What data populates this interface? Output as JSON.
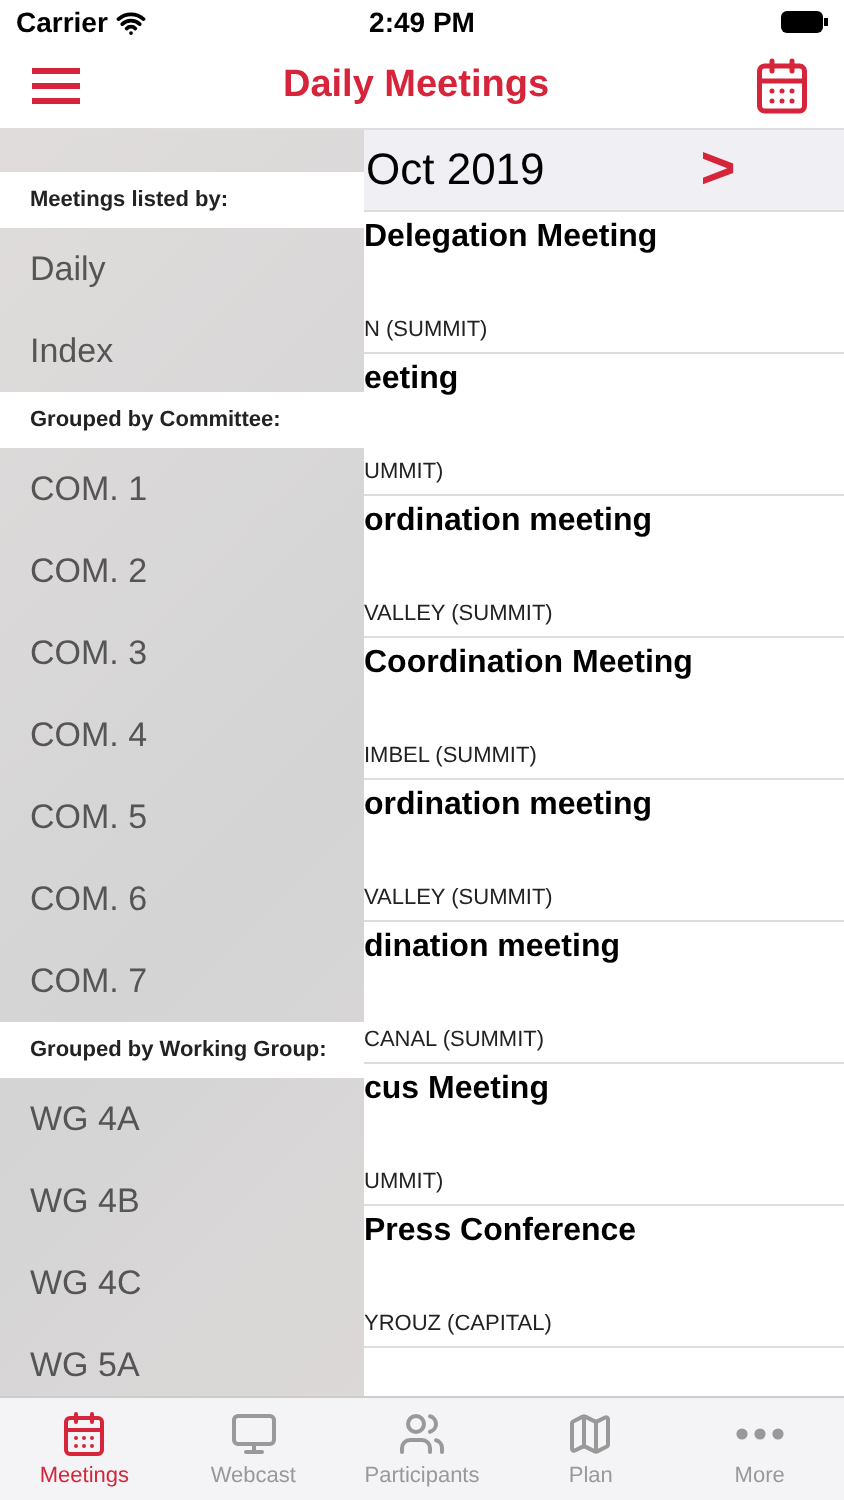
{
  "status_bar": {
    "carrier": "Carrier",
    "time": "2:49 PM"
  },
  "nav": {
    "title": "Daily Meetings"
  },
  "date_bar": {
    "date": "Oct 2019",
    "next": ">"
  },
  "meetings": [
    {
      "title": "Delegation Meeting",
      "location": "N (SUMMIT)"
    },
    {
      "title": "eeting",
      "location": "UMMIT)"
    },
    {
      "title": "ordination meeting",
      "location": "VALLEY (SUMMIT)"
    },
    {
      "title": "Coordination Meeting",
      "location": "IMBEL (SUMMIT)"
    },
    {
      "title": "ordination meeting",
      "location": "VALLEY (SUMMIT)"
    },
    {
      "title": "dination meeting",
      "location": "CANAL (SUMMIT)"
    },
    {
      "title": "cus Meeting",
      "location": "UMMIT)"
    },
    {
      "title": "Press Conference",
      "location": "YROUZ (CAPITAL)"
    }
  ],
  "sidebar": {
    "sections": [
      {
        "header": "Meetings listed by:",
        "items": [
          "Daily",
          "Index"
        ]
      },
      {
        "header": "Grouped by Committee:",
        "items": [
          "COM. 1",
          "COM. 2",
          "COM. 3",
          "COM. 4",
          "COM. 5",
          "COM. 6",
          "COM. 7"
        ]
      },
      {
        "header": "Grouped by Working Group:",
        "items": [
          "WG 4A",
          "WG 4B",
          "WG 4C",
          "WG 5A"
        ]
      }
    ]
  },
  "tab_bar": [
    {
      "kind": "calendar",
      "label": "Meetings",
      "selected": true
    },
    {
      "kind": "monitor",
      "label": "Webcast",
      "selected": false
    },
    {
      "kind": "people",
      "label": "Participants",
      "selected": false
    },
    {
      "kind": "map",
      "label": "Plan",
      "selected": false
    },
    {
      "kind": "more",
      "label": "More",
      "selected": false
    }
  ]
}
